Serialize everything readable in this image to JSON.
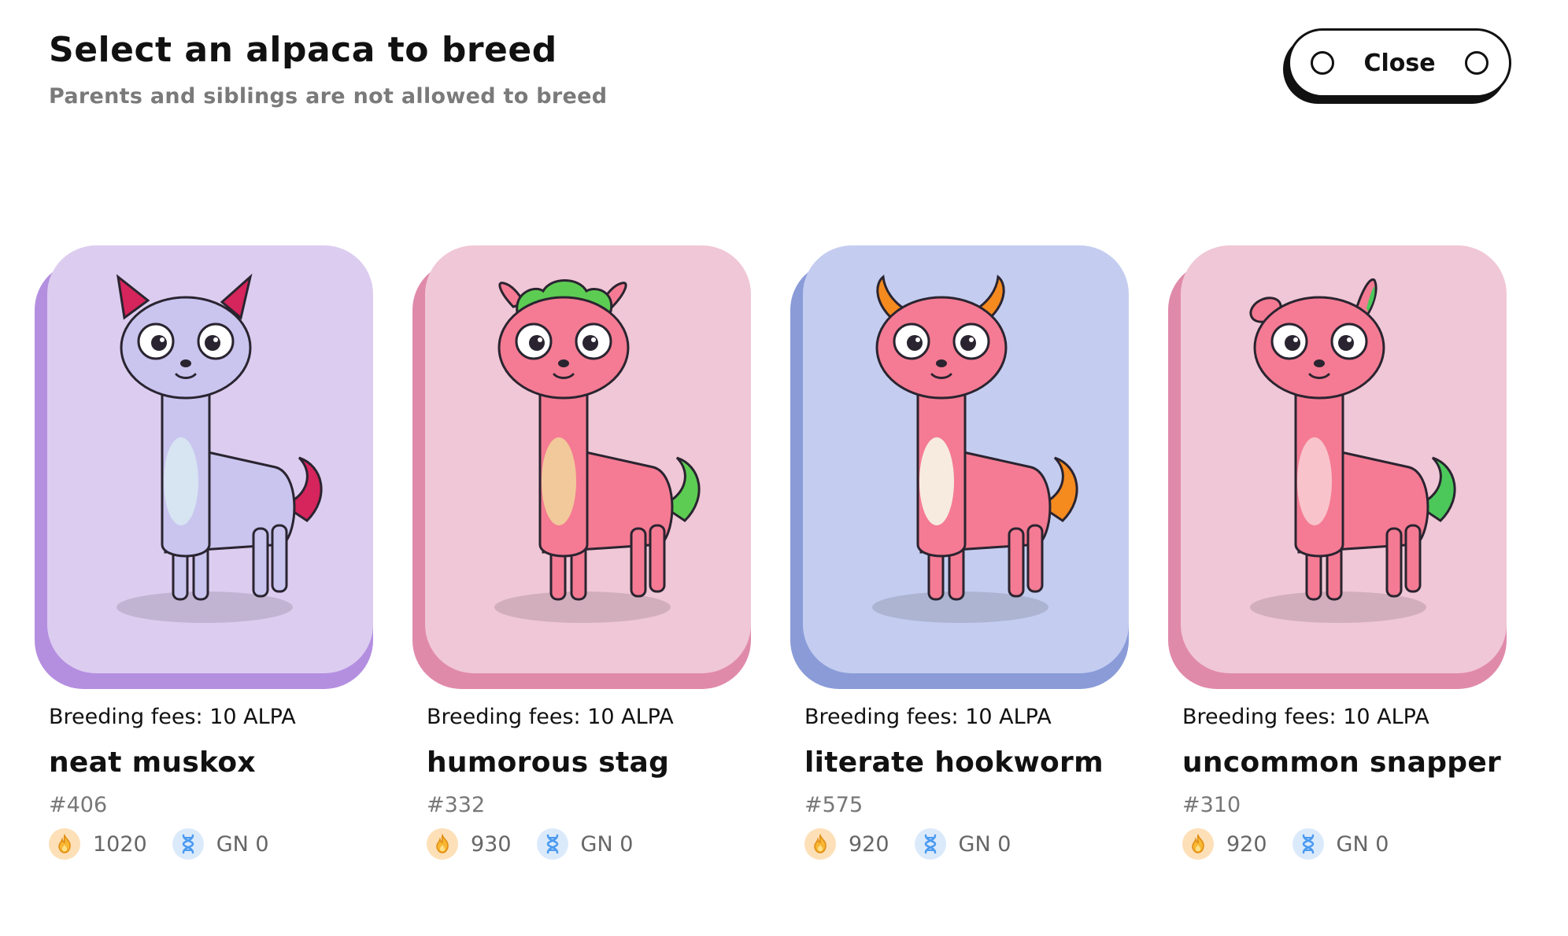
{
  "header": {
    "title": "Select an alpaca to breed",
    "subtitle": "Parents and siblings are not allowed to breed"
  },
  "close_button": {
    "label": "Close"
  },
  "icons": {
    "fire": "fire-icon",
    "dna": "dna-icon",
    "close_left": "circle-icon",
    "close_right": "circle-icon"
  },
  "cards": [
    {
      "fees": "Breeding fees: 10 ALPA",
      "name": "neat muskox",
      "id": "#406",
      "energy": "1020",
      "gen": "GN 0",
      "bg": "#dccdf0",
      "shadow": "#b48fe0",
      "body": "#c9c5ef",
      "accent": "#d6245c"
    },
    {
      "fees": "Breeding fees: 10 ALPA",
      "name": "humorous stag",
      "id": "#332",
      "energy": "930",
      "gen": "GN 0",
      "bg": "#f0c7d6",
      "shadow": "#e08aaa",
      "body": "#f47b93",
      "accent": "#5ccd52"
    },
    {
      "fees": "Breeding fees: 10 ALPA",
      "name": "literate hookworm",
      "id": "#575",
      "energy": "920",
      "gen": "GN 0",
      "bg": "#c4cdf0",
      "shadow": "#8a9bd8",
      "body": "#f47b93",
      "accent": "#f58a1f"
    },
    {
      "fees": "Breeding fees: 10 ALPA",
      "name": "uncommon snapper",
      "id": "#310",
      "energy": "920",
      "gen": "GN 0",
      "bg": "#f0c7d6",
      "shadow": "#e08aaa",
      "body": "#f47b93",
      "accent": "#4cc85a"
    }
  ]
}
